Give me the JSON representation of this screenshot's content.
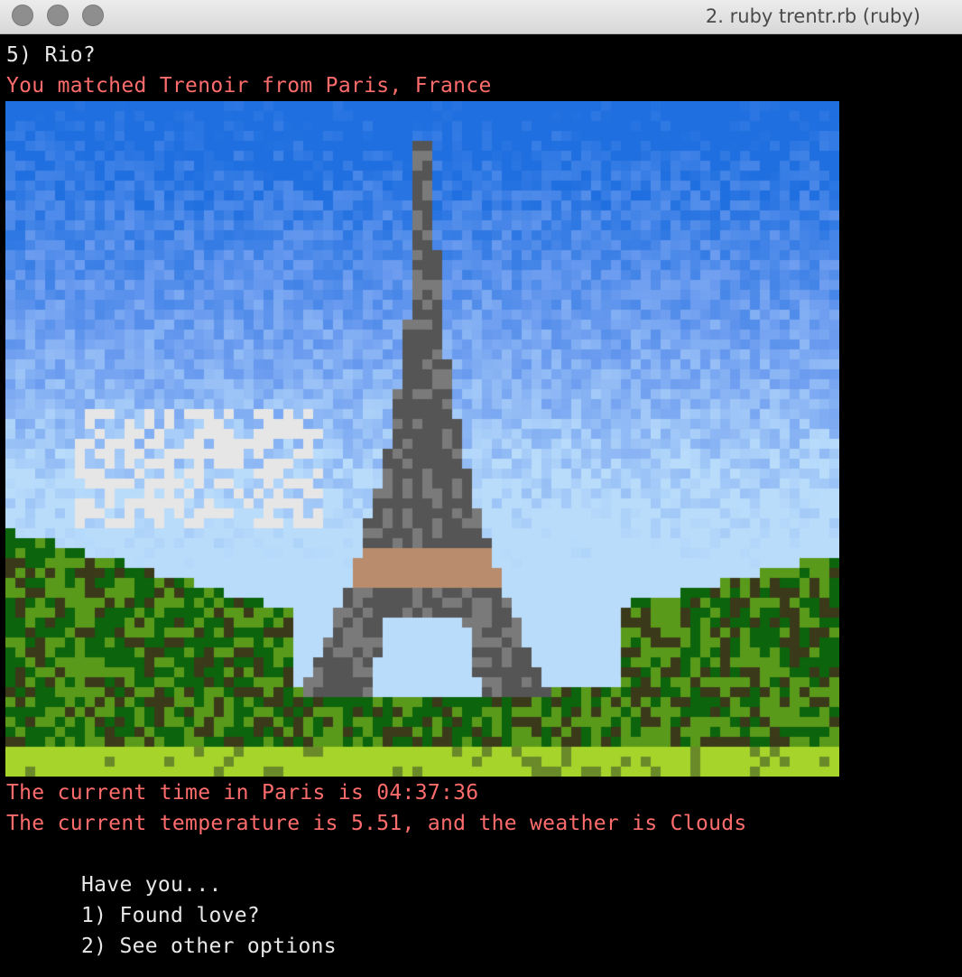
{
  "window": {
    "title": "2. ruby trentr.rb (ruby)",
    "buttons": [
      "close-button",
      "minimize-button",
      "zoom-button"
    ]
  },
  "terminal": {
    "prompt_line": "5) Rio?",
    "match_line": "You matched Trenoir from Paris, France",
    "time_line": "The current time in Paris is 04:37:36",
    "weather_line": "The current temperature is 5.51, and the weather is Clouds",
    "menu": {
      "heading": "Have you...",
      "options": [
        "1) Found love?",
        "2) See other options"
      ]
    }
  },
  "image": {
    "subject": "eiffel-tower-pixel-art",
    "colors": {
      "sky_deep": "#1f6fe0",
      "sky_mid": "#6f9ef0",
      "sky_light": "#b9dcfb",
      "cloud": "#e6e6e6",
      "tower_dark": "#555555",
      "tower_tan": "#b88c6c",
      "trees": "#0c640c",
      "grass": "#a6d42a"
    }
  },
  "colors": {
    "background": "#000000",
    "text": "#e8e8e8",
    "highlight_text": "#ff6c6c"
  }
}
